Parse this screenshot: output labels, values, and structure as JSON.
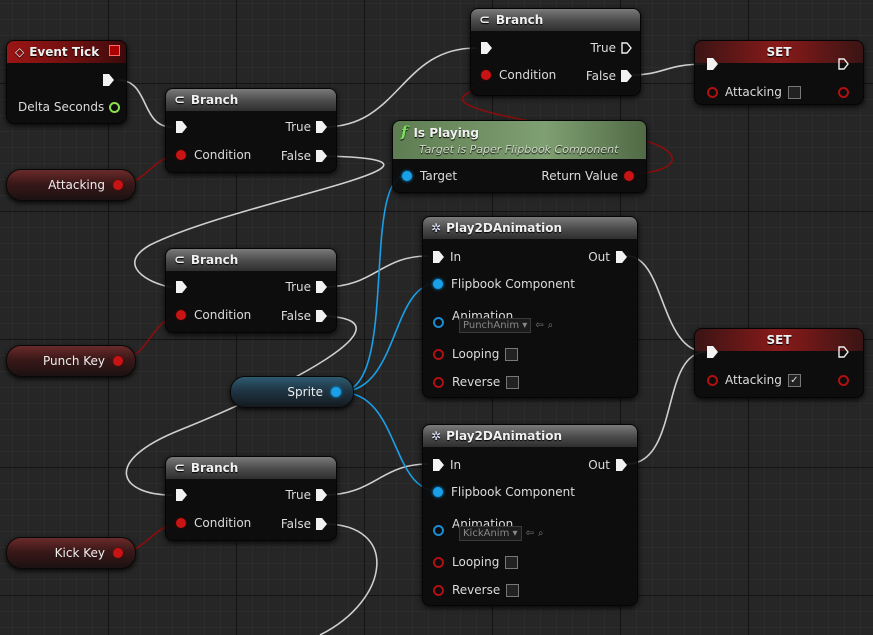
{
  "event_tick": {
    "title": "Event Tick",
    "delta_label": "Delta Seconds"
  },
  "branch": {
    "title": "Branch",
    "true_label": "True",
    "false_label": "False",
    "condition_label": "Condition"
  },
  "is_playing": {
    "title": "Is Playing",
    "subtitle": "Target is Paper Flipbook Component",
    "target_label": "Target",
    "return_label": "Return Value"
  },
  "play2d": {
    "title": "Play2DAnimation",
    "in_label": "In",
    "out_label": "Out",
    "flipbook_label": "Flipbook Component",
    "animation_label": "Animation",
    "looping_label": "Looping",
    "reverse_label": "Reverse"
  },
  "play2d_punch": {
    "animation_value": "PunchAnim"
  },
  "play2d_kick": {
    "animation_value": "KickAnim"
  },
  "set_node": {
    "title": "SET",
    "attacking_label": "Attacking"
  },
  "vars": {
    "attacking": "Attacking",
    "punch_key": "Punch Key",
    "kick_key": "Kick Key",
    "sprite": "Sprite"
  },
  "colors": {
    "exec": "#f2f2f2",
    "bool": "#c81414",
    "object": "#1aa0e8",
    "float": "#8ce14a"
  }
}
